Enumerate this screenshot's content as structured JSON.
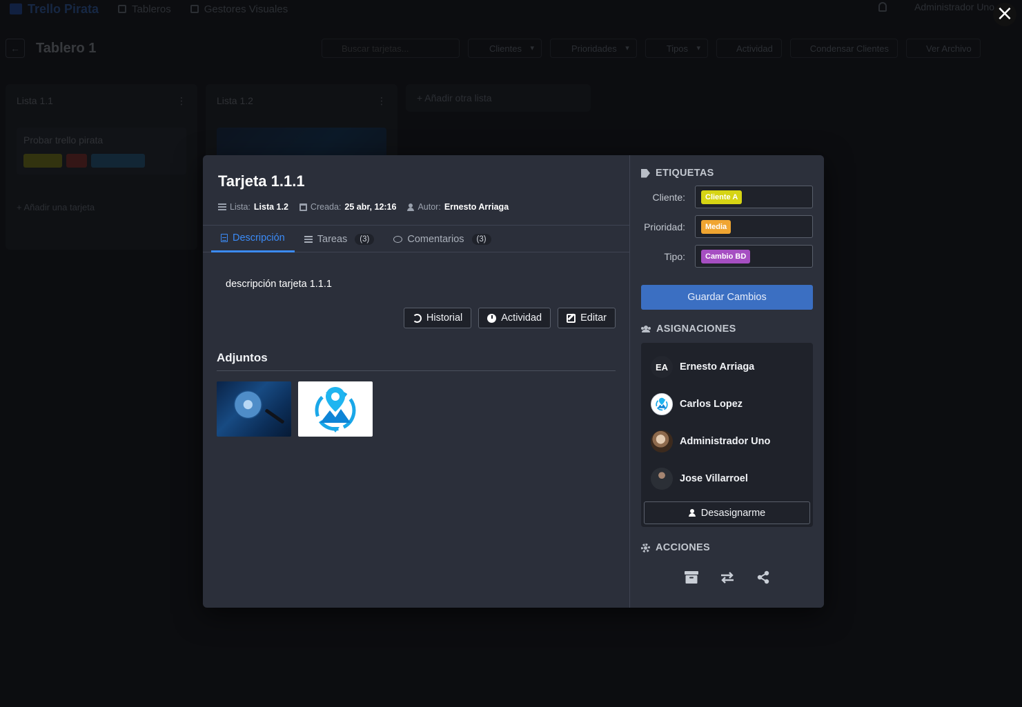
{
  "background": {
    "brand": "Trello Pirata",
    "nav": [
      "Tableros",
      "Gestores Visuales"
    ],
    "user": "Administrador Uno",
    "board_title": "Tablero 1",
    "search_placeholder": "Buscar tarjetas...",
    "filters": [
      "Clientes",
      "Prioridades",
      "Tipos"
    ],
    "tools": [
      "Actividad",
      "Condensar Clientes",
      "Ver Archivo"
    ],
    "lists": [
      {
        "title": "Lista 1.1",
        "card": "Probar trello pirata",
        "add": "+ Añadir una tarjeta"
      },
      {
        "title": "Lista 1.2"
      }
    ],
    "add_list": "+ Añadir otra lista"
  },
  "close_icon": "×",
  "card": {
    "title": "Tarjeta 1.1.1",
    "meta": {
      "list_label": "Lista:",
      "list_value": "Lista 1.2",
      "created_label": "Creada:",
      "created_value": "25 abr, 12:16",
      "author_label": "Autor:",
      "author_value": "Ernesto Arriaga"
    },
    "tabs": [
      {
        "label": "Descripción",
        "active": true
      },
      {
        "label": "Tareas",
        "count": "(3)"
      },
      {
        "label": "Comentarios",
        "count": "(3)"
      }
    ],
    "description": "descripción tarjeta 1.1.1",
    "buttons": {
      "history": "Historial",
      "activity": "Actividad",
      "edit": "Editar"
    },
    "attachments_title": "Adjuntos"
  },
  "side": {
    "labels_title": "ETIQUETAS",
    "labels": [
      {
        "name": "Cliente:",
        "value": "Cliente A",
        "bg": "#d6d414",
        "fg": "#ffffff"
      },
      {
        "name": "Prioridad:",
        "value": "Media",
        "bg": "#f0a531",
        "fg": "#ffffff"
      },
      {
        "name": "Tipo:",
        "value": "Cambio BD",
        "bg": "#a64fc2",
        "fg": "#ffffff"
      }
    ],
    "save_label": "Guardar Cambios",
    "assign_title": "ASIGNACIONES",
    "people": [
      {
        "initials": "EA",
        "name": "Ernesto Arriaga"
      },
      {
        "initials": "",
        "name": "Carlos Lopez"
      },
      {
        "initials": "",
        "name": "Administrador Uno"
      },
      {
        "initials": "",
        "name": "Jose Villarroel"
      }
    ],
    "unassign_label": "Desasignarme",
    "actions_title": "ACCIONES",
    "action_icons": [
      "archive-icon",
      "move-icon",
      "share-icon"
    ]
  },
  "colors": {
    "accent": "#3b8bf7",
    "save": "#3b6fc2",
    "modal_bg": "#2b2f3a"
  }
}
